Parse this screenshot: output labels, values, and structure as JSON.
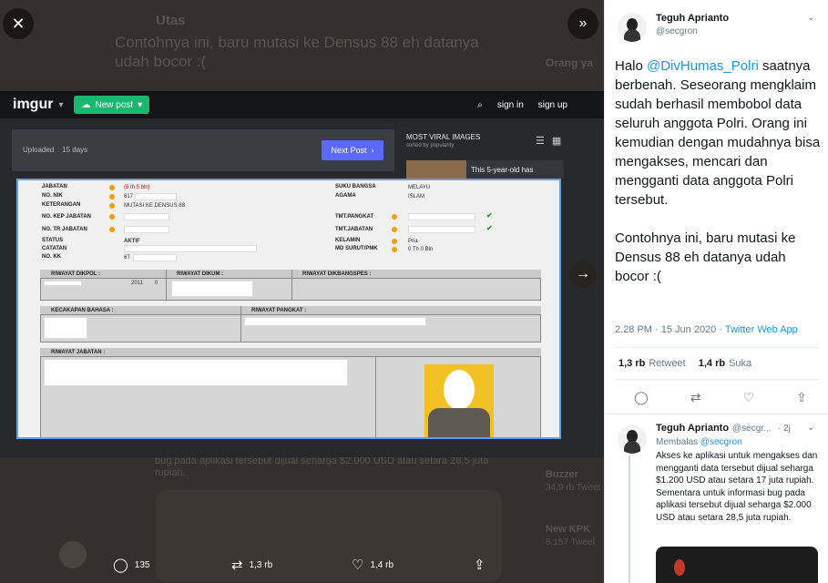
{
  "viewer": {
    "close_icon": "✕",
    "collapse_icon": "»",
    "next_icon": "→",
    "bg": {
      "utas": "Utas",
      "quoted_text": "Contohnya ini, baru mutasi ke Densus 88 eh datanya udah bocor :(",
      "orang_ya": "Orang ya",
      "bottom_text": "bug pada aplikasi tersebut dijual seharga $2.000 USD atau setara 28,5 juta rupiah.",
      "buzzer": "Buzzer",
      "buzzer_sub": "34,9 rb Tweet",
      "newkpk": "New KPK",
      "newkpk_sub": "8.157 Tweet"
    },
    "imgur": {
      "logo": "imgur",
      "new_post": "New post",
      "sign_in": "sign in",
      "sign_up": "sign up",
      "uploaded_label": "Uploaded",
      "uploaded_value": "15 days",
      "next_post": "Next Post",
      "most_viral": "MOST VIRAL IMAGES",
      "sorted_by": "sorted by popularity",
      "viral_caption": "This 5-year-old has"
    },
    "document": {
      "jabatan": "JABATAN",
      "jabatan_val": "(5 th 5 bln)",
      "no_nik": "NO. NIK",
      "nik_val": "617",
      "keterangan": "KETERANGAN",
      "keterangan_val": "MUTASI KE DENSUS 88",
      "no_kep": "NO. KEP JABATAN",
      "no_tr": "NO. TR JABATAN",
      "status": "STATUS",
      "status_val": "AKTIF",
      "catatan": "CATATAN",
      "no_kk": "NO. KK",
      "kk_val": "6T",
      "suku": "SUKU BANGSA",
      "suku_val": "MELAYU",
      "agama": "AGAMA",
      "agama_val": "ISLAM",
      "tmt_pangkat": "TMT.PANGKAT",
      "tmt_jabatan": "TMT.JABATAN",
      "kelamin": "KELAMIN",
      "kelamin_val": "Pria",
      "md_suru": "MD SURUT/PMK",
      "md_val": "0 Th  0 Bln",
      "riwayat_dikpol": "RIWAYAT DIKPOL :",
      "dikpol_year": "2011",
      "dikpol_n": "0",
      "riwayat_dikum": "RIWAYAT DIKUM :",
      "riwayat_dikbang": "RIWAYAT DIKBANGSPES :",
      "kecakapan": "KECAKAPAN BAHASA :",
      "riwayat_pangkat": "RIWAYAT PANGKAT :",
      "riwayat_jabatan": "RIWAYAT JABATAN :"
    },
    "actions": {
      "reply_count": "135",
      "retweet_count": "1,3 rb",
      "like_count": "1,4 rb"
    }
  },
  "tweet": {
    "name": "Teguh Aprianto",
    "handle": "@secgron",
    "text_pre": "Halo ",
    "mention": "@DivHumas_Polri",
    "text_post": " saatnya berbenah. Seseorang mengklaim sudah berhasil membobol data seluruh anggota Polri. Orang ini kemudian dengan mudahnya bisa mengakses, mencari dan mengganti data anggota Polri tersebut.",
    "text2": "Contohnya ini, baru mutasi ke Densus 88 eh datanya udah bocor :(",
    "time": "2.28 PM · 15 Jun 2020 · ",
    "source": "Twitter Web App",
    "retweets": "1,3 rb",
    "retweets_label": "Retweet",
    "likes": "1,4 rb",
    "likes_label": "Suka"
  },
  "reply": {
    "name": "Teguh Aprianto",
    "handle": "@secgr...",
    "age": "· 2j",
    "replying_label": "Membalas ",
    "replying_to": "@secgron",
    "text": "Akses ke aplikasi untuk mengakses dan mengganti data tersebut dijual seharga $1.200 USD atau setara 17 juta rupiah. Sementara untuk informasi bug pada aplikasi tersebut dijual seharga $2.000 USD atau setara 28,5 juta rupiah."
  }
}
